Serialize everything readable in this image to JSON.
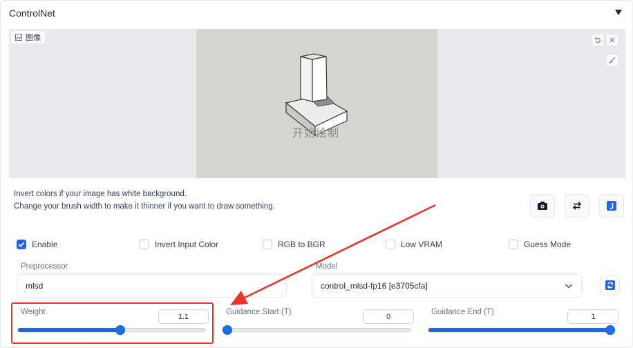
{
  "accordion": {
    "title": "ControlNet",
    "toggle_icon": "triangle-down-icon"
  },
  "image_panel": {
    "label": "图像",
    "overlay_text": "开始绘制",
    "icons": [
      "image-icon",
      "undo-icon",
      "close-icon",
      "brush-icon"
    ]
  },
  "hints": {
    "line1": "Invert colors if your image has white background.",
    "line2": "Change your brush width to make it thinner if you want to draw something."
  },
  "icon_buttons": [
    "camera-icon",
    "swap-arrows-icon",
    "j-icon"
  ],
  "checkboxes": [
    {
      "label": "Enable",
      "checked": true
    },
    {
      "label": "Invert Input Color",
      "checked": false
    },
    {
      "label": "RGB to BGR",
      "checked": false
    },
    {
      "label": "Low VRAM",
      "checked": false
    },
    {
      "label": "Guess Mode",
      "checked": false
    }
  ],
  "preprocessor": {
    "label": "Preprocessor",
    "value": "mlsd"
  },
  "model": {
    "label": "Model",
    "value": "control_mlsd-fp16 [e3705cfa]"
  },
  "sliders": {
    "weight": {
      "label": "Weight",
      "value": "1.1",
      "fraction": 0.55
    },
    "guidance_start": {
      "label": "Guidance Start (T)",
      "value": "0",
      "fraction": 0.0
    },
    "guidance_end": {
      "label": "Guidance End (T)",
      "value": "1",
      "fraction": 1.0
    }
  },
  "colors": {
    "accent": "#2563eb",
    "annotation": "#e8352a"
  }
}
